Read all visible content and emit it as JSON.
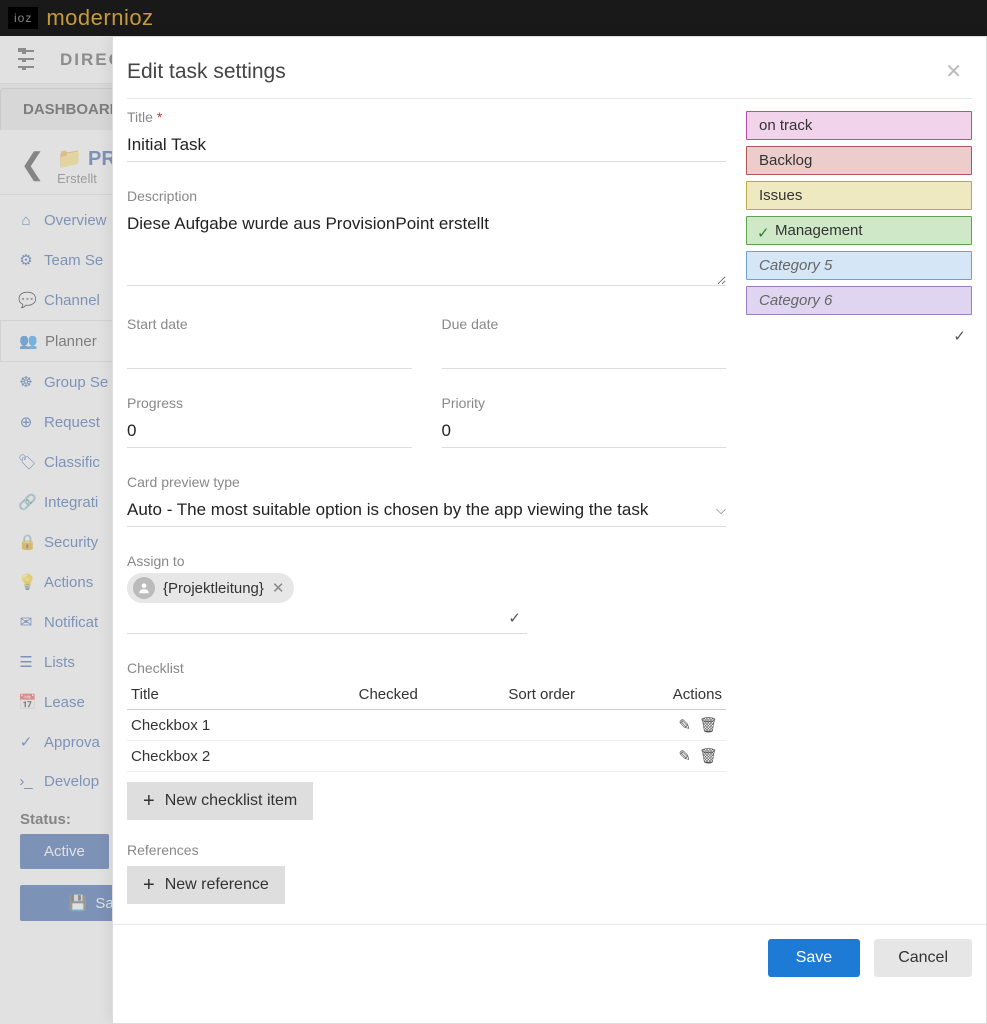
{
  "topbar": {
    "ioz": "ioz",
    "brand": "modernioz"
  },
  "subbar": {
    "label": "DIRECTORY"
  },
  "tabs": {
    "dashboard": "DASHBOARD"
  },
  "header": {
    "title": "PRO",
    "subtitle": "Erstellt "
  },
  "sidebar": {
    "items": [
      {
        "label": "Overview"
      },
      {
        "label": "Team Se"
      },
      {
        "label": "Channel"
      },
      {
        "label": "Planner"
      },
      {
        "label": "Group Se"
      },
      {
        "label": "Request"
      },
      {
        "label": "Classific"
      },
      {
        "label": "Integrati"
      },
      {
        "label": "Security"
      },
      {
        "label": "Actions"
      },
      {
        "label": "Notificat"
      },
      {
        "label": "Lists"
      },
      {
        "label": "Lease"
      },
      {
        "label": "Approva"
      },
      {
        "label": "Develop"
      }
    ]
  },
  "status": {
    "label": "Status:",
    "value": "Active",
    "save": "Sav"
  },
  "modal": {
    "title": "Edit task settings",
    "labels": {
      "title": "Title",
      "required": "*",
      "description": "Description",
      "start_date": "Start date",
      "due_date": "Due date",
      "progress": "Progress",
      "priority": "Priority",
      "card_preview": "Card preview type",
      "assign_to": "Assign to",
      "checklist": "Checklist",
      "references": "References"
    },
    "values": {
      "title": "Initial Task",
      "description": "Diese Aufgabe wurde aus ProvisionPoint erstellt",
      "start_date": "",
      "due_date": "",
      "progress": "0",
      "priority": "0",
      "card_preview": "Auto - The most suitable option is chosen by the app viewing the task",
      "assignee": "{Projektleitung}"
    },
    "checklist": {
      "headers": {
        "title": "Title",
        "checked": "Checked",
        "sort": "Sort order",
        "actions": "Actions"
      },
      "rows": [
        {
          "title": "Checkbox 1"
        },
        {
          "title": "Checkbox 2"
        }
      ],
      "add": "New checklist item"
    },
    "references": {
      "add": "New reference"
    },
    "categories": [
      {
        "label": "on track",
        "bg": "#f1d4eb",
        "border": "#b84ea2",
        "checked": false,
        "italic": false
      },
      {
        "label": "Backlog",
        "bg": "#edcccc",
        "border": "#b55454",
        "checked": false,
        "italic": false
      },
      {
        "label": "Issues",
        "bg": "#eee9c0",
        "border": "#b9ab4a",
        "checked": false,
        "italic": false
      },
      {
        "label": "Management",
        "bg": "#cfe9c8",
        "border": "#5fa352",
        "checked": true,
        "italic": false
      },
      {
        "label": "Category 5",
        "bg": "#d5e6f6",
        "border": "#6fa2d2",
        "checked": false,
        "italic": true
      },
      {
        "label": "Category 6",
        "bg": "#e0d5f0",
        "border": "#9b7fc2",
        "checked": false,
        "italic": true
      }
    ],
    "footer": {
      "save": "Save",
      "cancel": "Cancel"
    }
  }
}
